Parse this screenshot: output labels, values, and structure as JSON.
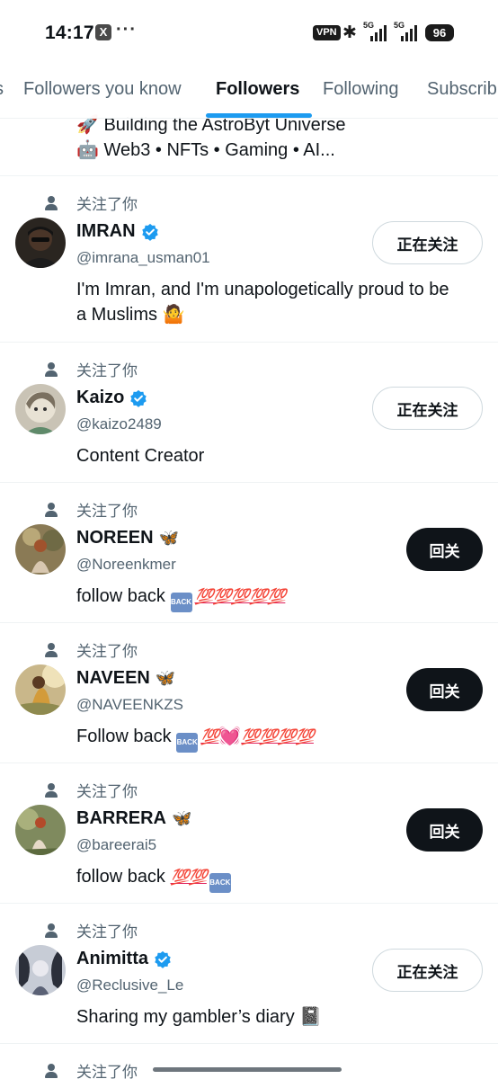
{
  "status_bar": {
    "time": "14:17",
    "app_icon": "x-icon",
    "more": "···",
    "vpn": "VPN",
    "network1": "5G",
    "network2": "5G",
    "battery": "96"
  },
  "tabs": [
    {
      "label": "s",
      "active": false
    },
    {
      "label": "Followers you know",
      "active": false
    },
    {
      "label": "Followers",
      "active": true
    },
    {
      "label": "Following",
      "active": false
    },
    {
      "label": "Subscrib",
      "active": false
    }
  ],
  "top_partial_bio": {
    "line1": "🚀 Building the AstroByt Universe",
    "line2": "🤖 Web3 • NFTs • Gaming • AI..."
  },
  "follows_you_label": "关注了你",
  "follow_button": {
    "following": "正在关注",
    "follow_back": "回关"
  },
  "users": [
    {
      "name": "IMRAN",
      "verified": true,
      "handle": "@imrana_usman01",
      "bio_line1": "I'm Imran, and I'm unapologetically proud to be",
      "bio_line2": "a Muslims 🤷",
      "button": "following"
    },
    {
      "name": "Kaizo",
      "verified": true,
      "handle": "@kaizo2489",
      "bio_line1": "Content Creator",
      "button": "following"
    },
    {
      "name": "NOREEN",
      "butterfly": "🦋",
      "handle": "@Noreenkmer",
      "bio_text": "follow back",
      "bio_emojis": "💯💯💯💯💯",
      "button": "follow_back"
    },
    {
      "name": "NAVEEN",
      "butterfly": "🦋",
      "handle": "@NAVEENKZS",
      "bio_text": "Follow back",
      "bio_emojis_a": "💯",
      "bio_heart": "💓",
      "bio_emojis_b": "💯💯💯💯",
      "button": "follow_back"
    },
    {
      "name": "BARRERA",
      "butterfly": "🦋",
      "handle": "@bareerai5",
      "bio_text": "follow back",
      "bio_emojis": "💯💯",
      "button": "follow_back"
    },
    {
      "name": "Animitta",
      "verified": true,
      "handle": "@Reclusive_Le",
      "bio_line1": "Sharing my gambler’s diary 📓",
      "button": "following"
    }
  ],
  "colors": {
    "accent": "#1d9bf0",
    "text": "#0f1419",
    "secondary": "#536471",
    "border": "#cfd9de"
  }
}
